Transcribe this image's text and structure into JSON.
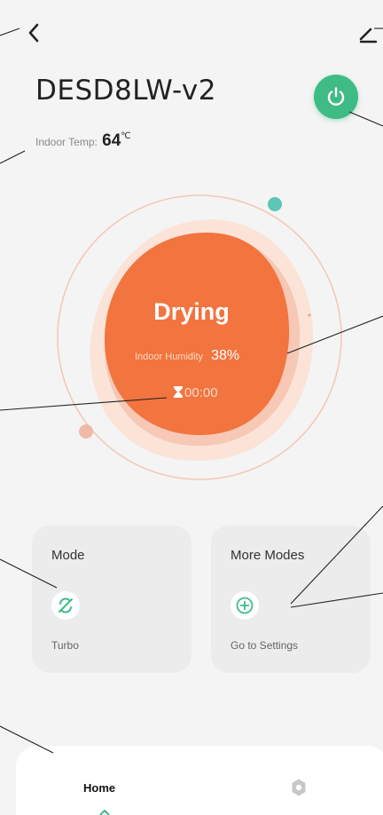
{
  "header": {
    "device_name": "DESD8LW-v2",
    "indoor_temp_label": "Indoor Temp:",
    "indoor_temp_value": "64",
    "indoor_temp_unit": "℃"
  },
  "status": {
    "mode_label": "Drying",
    "humidity_label": "Indoor Humidity",
    "humidity_value": "38%",
    "timer": "00:00"
  },
  "cards": {
    "mode": {
      "title": "Mode",
      "value": "Turbo"
    },
    "more_modes": {
      "title": "More Modes",
      "action": "Go to Settings"
    }
  },
  "tabs": {
    "home": "Home"
  },
  "colors": {
    "accent_green": "#3fbb86",
    "status_orange": "#f2743f",
    "card_bg": "#ececec"
  },
  "icons": {
    "back": "chevron-left-icon",
    "edit": "pencil-icon",
    "power": "power-icon",
    "timer": "hourglass-icon",
    "mode": "turbo-icon",
    "more_modes": "plus-circle-icon",
    "settings": "gear-icon"
  }
}
